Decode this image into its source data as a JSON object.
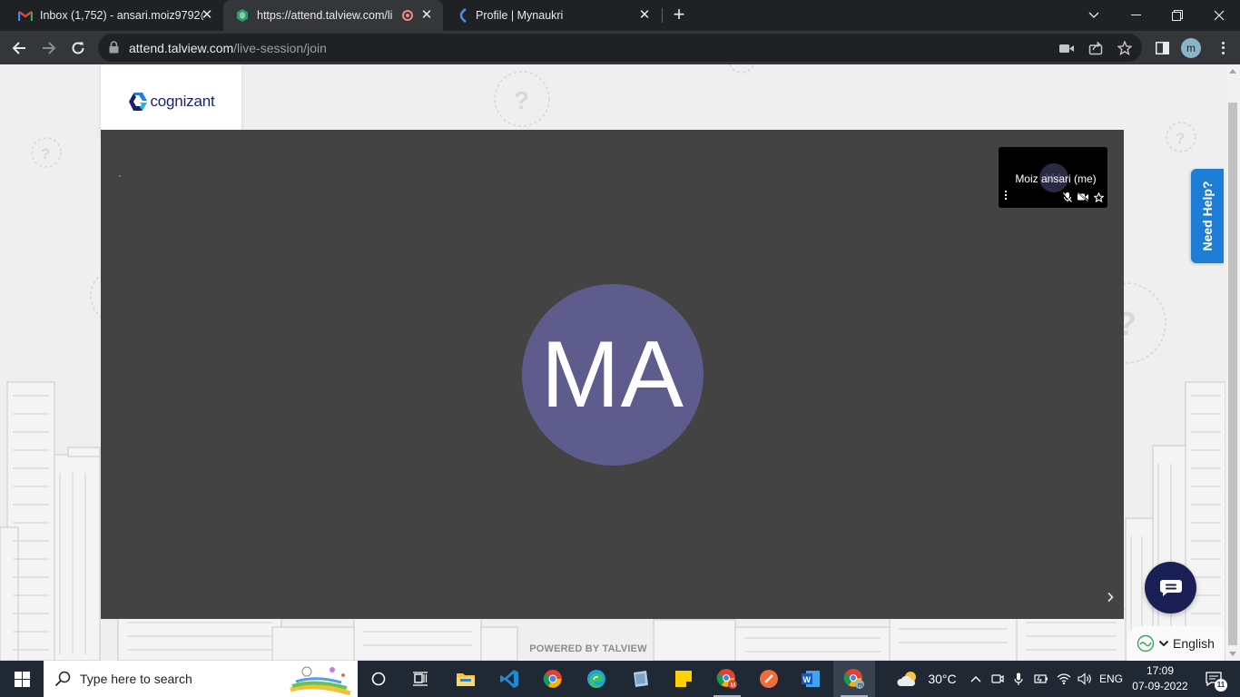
{
  "browser": {
    "tabs": [
      {
        "title": "Inbox (1,752) - ansari.moiz9792@",
        "icon": "gmail-icon"
      },
      {
        "title": "https://attend.talview.com/li",
        "icon": "talview-icon",
        "recording": true
      },
      {
        "title": "Profile | Mynaukri",
        "icon": "naukri-icon"
      }
    ],
    "url_domain": "attend.talview.com",
    "url_path": "/live-session/join",
    "profile_initial": "m"
  },
  "page": {
    "logo_text": "cognizant",
    "main_participant_initials": "MA",
    "self_tile": {
      "initials": "MA",
      "name": "Moiz ansari (me)"
    },
    "need_help_label": "Need Help?",
    "powered_by": "POWERED BY TALVIEW",
    "language": "English"
  },
  "taskbar": {
    "search_placeholder": "Type here to search",
    "weather": "30°C",
    "language": "ENG",
    "time": "17:09",
    "date": "07-09-2022",
    "notification_count": "11"
  }
}
